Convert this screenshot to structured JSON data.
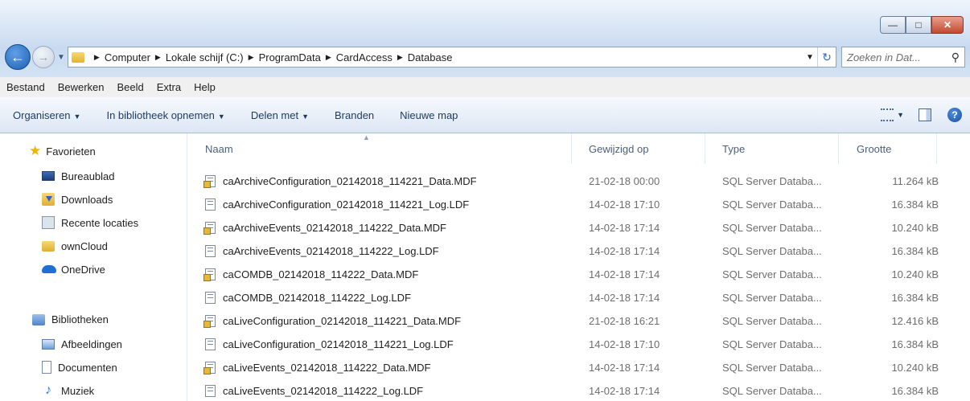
{
  "window": {
    "minimize": "—",
    "maximize": "□",
    "close": "✕"
  },
  "address": {
    "breadcrumbs": [
      "Computer",
      "Lokale schijf (C:)",
      "ProgramData",
      "CardAccess",
      "Database"
    ]
  },
  "search": {
    "placeholder": "Zoeken in Dat..."
  },
  "menu": [
    "Bestand",
    "Bewerken",
    "Beeld",
    "Extra",
    "Help"
  ],
  "commands": [
    {
      "label": "Organiseren",
      "dropdown": true
    },
    {
      "label": "In bibliotheek opnemen",
      "dropdown": true
    },
    {
      "label": "Delen met",
      "dropdown": true
    },
    {
      "label": "Branden",
      "dropdown": false
    },
    {
      "label": "Nieuwe map",
      "dropdown": false
    }
  ],
  "sidebar": {
    "favorites_title": "Favorieten",
    "favorites": [
      "Bureaublad",
      "Downloads",
      "Recente locaties",
      "ownCloud",
      "OneDrive"
    ],
    "libraries_title": "Bibliotheken",
    "libraries": [
      "Afbeeldingen",
      "Documenten",
      "Muziek"
    ]
  },
  "columns": {
    "name": "Naam",
    "modified": "Gewijzigd op",
    "type": "Type",
    "size": "Grootte"
  },
  "files": [
    {
      "name": "caArchiveConfiguration_02142018_114221_Data.MDF",
      "modified": "21-02-18 00:00",
      "type": "SQL Server Databa...",
      "size": "11.264 kB",
      "kind": "data"
    },
    {
      "name": "caArchiveConfiguration_02142018_114221_Log.LDF",
      "modified": "14-02-18 17:10",
      "type": "SQL Server Databa...",
      "size": "16.384 kB",
      "kind": "log"
    },
    {
      "name": "caArchiveEvents_02142018_114222_Data.MDF",
      "modified": "14-02-18 17:14",
      "type": "SQL Server Databa...",
      "size": "10.240 kB",
      "kind": "data"
    },
    {
      "name": "caArchiveEvents_02142018_114222_Log.LDF",
      "modified": "14-02-18 17:14",
      "type": "SQL Server Databa...",
      "size": "16.384 kB",
      "kind": "log"
    },
    {
      "name": "caCOMDB_02142018_114222_Data.MDF",
      "modified": "14-02-18 17:14",
      "type": "SQL Server Databa...",
      "size": "10.240 kB",
      "kind": "data"
    },
    {
      "name": "caCOMDB_02142018_114222_Log.LDF",
      "modified": "14-02-18 17:14",
      "type": "SQL Server Databa...",
      "size": "16.384 kB",
      "kind": "log"
    },
    {
      "name": "caLiveConfiguration_02142018_114221_Data.MDF",
      "modified": "21-02-18 16:21",
      "type": "SQL Server Databa...",
      "size": "12.416 kB",
      "kind": "data"
    },
    {
      "name": "caLiveConfiguration_02142018_114221_Log.LDF",
      "modified": "14-02-18 17:10",
      "type": "SQL Server Databa...",
      "size": "16.384 kB",
      "kind": "log"
    },
    {
      "name": "caLiveEvents_02142018_114222_Data.MDF",
      "modified": "14-02-18 17:14",
      "type": "SQL Server Databa...",
      "size": "10.240 kB",
      "kind": "data"
    },
    {
      "name": "caLiveEvents_02142018_114222_Log.LDF",
      "modified": "14-02-18 17:14",
      "type": "SQL Server Databa...",
      "size": "16.384 kB",
      "kind": "log"
    }
  ]
}
